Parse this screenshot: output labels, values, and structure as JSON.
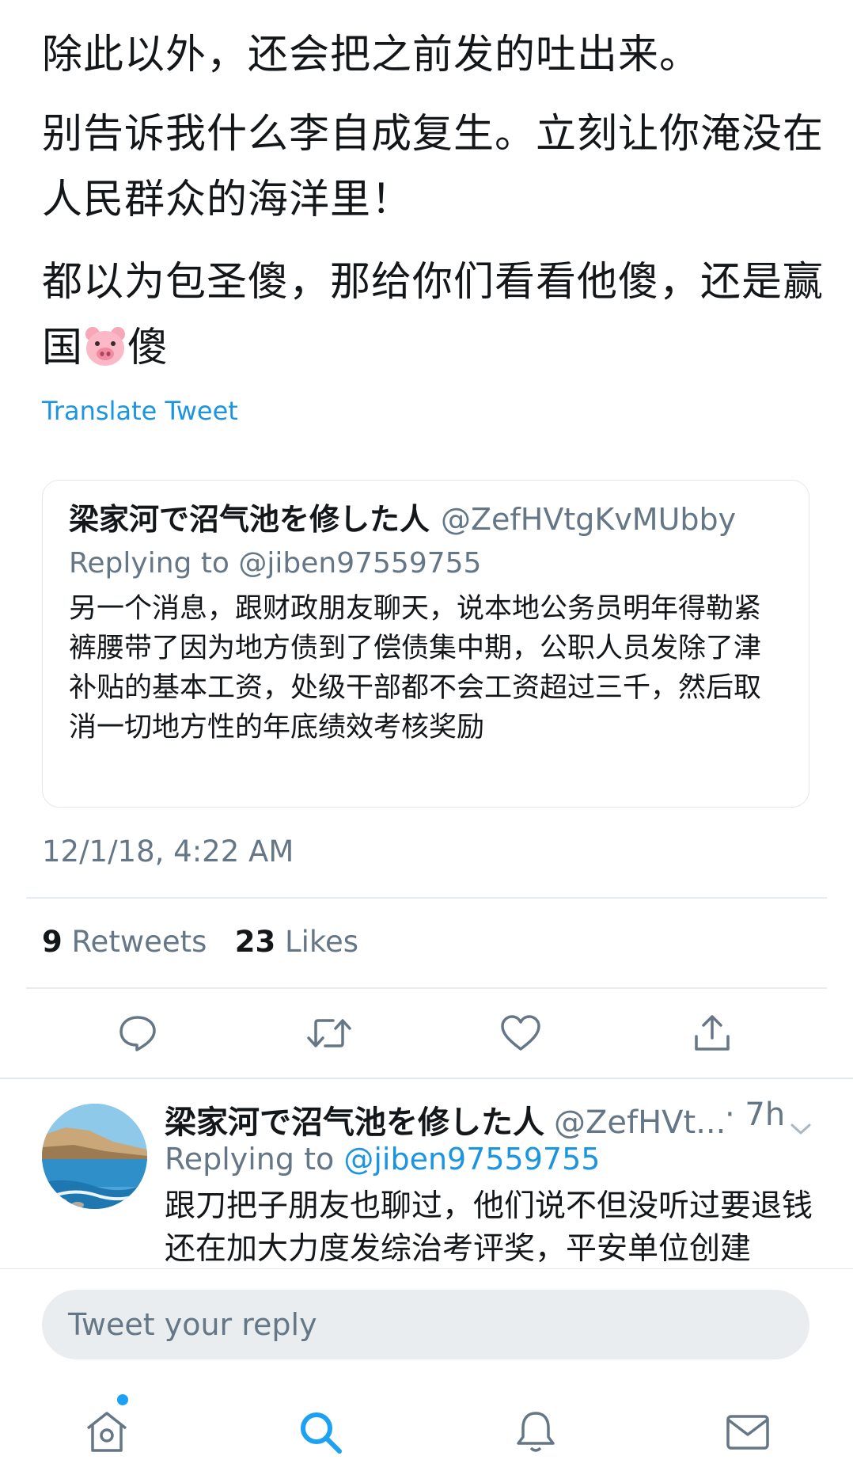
{
  "tweet": {
    "paragraphs": [
      "除此以外，还会把之前发的吐出来。",
      "别告诉我什么李自成复生。立刻让你淹没在人民群众的海洋里！",
      "都以为包圣傻，那给你们看看他傻，还是赢国"
    ],
    "para3_suffix": "傻",
    "translate_label": "Translate Tweet",
    "timestamp": "12/1/18, 4:22 AM",
    "retweets_count": "9",
    "retweets_label": "Retweets",
    "likes_count": "23",
    "likes_label": "Likes"
  },
  "quoted_tweet": {
    "display_name": "梁家河で沼气池を修した人",
    "handle": "@ZefHVtgKvMUbby",
    "replying_to": "Replying to @jiben97559755",
    "text": "另一个消息，跟财政朋友聊天，说本地公务员明年得勒紧裤腰带了因为地方债到了偿债集中期，公职人员发除了津补贴的基本工资，处级干部都不会工资超过三千，然后取消一切地方性的年底绩效考核奖励"
  },
  "reply": {
    "display_name": "梁家河で沼气池を修した人",
    "handle": "@ZefHVt...",
    "time": "· 7h",
    "replying_prefix": "Replying to",
    "replying_handle": "@jiben97559755",
    "text": "跟刀把子朋友也聊过，他们说不但没听过要退钱还在加大力度发综治考评奖，平安单位创建"
  },
  "composer": {
    "placeholder": "Tweet your reply"
  },
  "actions": [
    "reply-icon",
    "retweet-icon",
    "like-icon",
    "share-icon"
  ],
  "tab_bar": [
    "home-icon",
    "search-icon",
    "notifications-icon",
    "messages-icon"
  ],
  "colors": {
    "accent": "#1da1f2",
    "link": "#1b95e0",
    "secondary_text": "#657786",
    "icon_gray": "#657786"
  }
}
